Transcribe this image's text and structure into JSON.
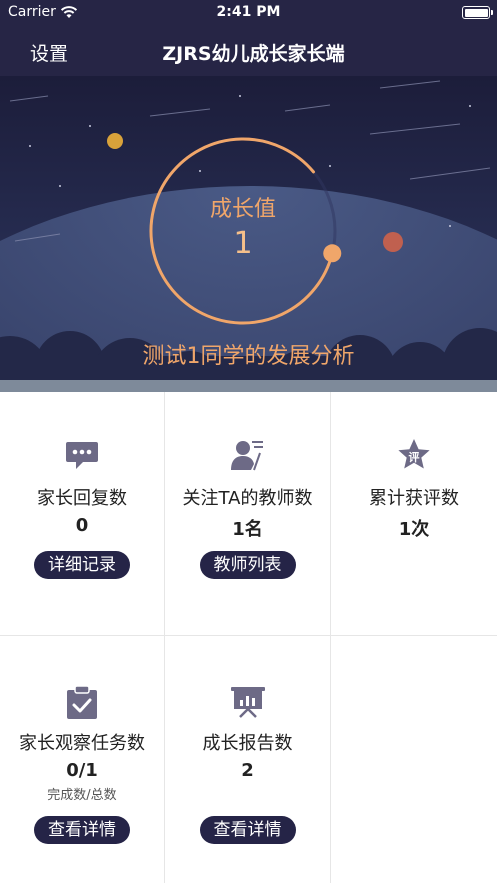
{
  "status_bar": {
    "carrier": "Carrier",
    "time": "2:41 PM"
  },
  "nav": {
    "settings_label": "设置",
    "title": "ZJRS幼儿成长家长端"
  },
  "hero": {
    "ring_label": "成长值",
    "ring_value": "1",
    "subtitle": "测试1同学的发展分析",
    "ring_progress": 0.85
  },
  "stats": [
    {
      "icon": "chat-bubble-icon",
      "label": "家长回复数",
      "value": "0",
      "button": "详细记录"
    },
    {
      "icon": "teacher-icon",
      "label": "关注TA的教师数",
      "value": "1名",
      "button": "教师列表"
    },
    {
      "icon": "star-badge-icon",
      "badge_text": "评",
      "label": "累计获评数",
      "value": "1次"
    },
    {
      "icon": "clipboard-check-icon",
      "label": "家长观察任务数",
      "value": "0/1",
      "note": "完成数/总数",
      "button": "查看详情"
    },
    {
      "icon": "presentation-board-icon",
      "label": "成长报告数",
      "value": "2",
      "button": "查看详情"
    }
  ],
  "colors": {
    "header_bg": "#262545",
    "accent": "#f0a66a",
    "button_bg": "#252447",
    "icon": "#6d6a86"
  }
}
